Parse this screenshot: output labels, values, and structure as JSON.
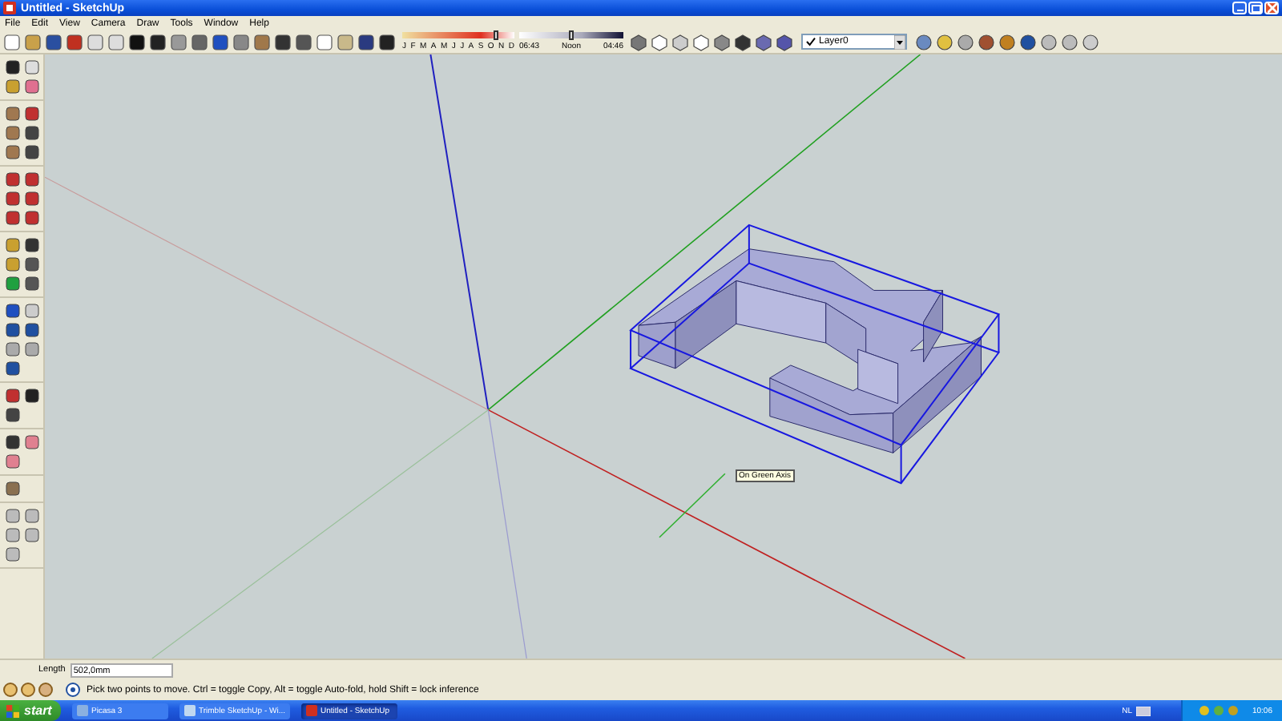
{
  "window": {
    "title": "Untitled - SketchUp"
  },
  "menu": [
    "File",
    "Edit",
    "View",
    "Camera",
    "Draw",
    "Tools",
    "Window",
    "Help"
  ],
  "toolbar": {
    "months": [
      "J",
      "F",
      "M",
      "A",
      "M",
      "J",
      "J",
      "A",
      "S",
      "O",
      "N",
      "D"
    ],
    "month_slider": {
      "level": 0.84
    },
    "time_slider": {
      "level": 0.5
    },
    "time_start": "06:43",
    "time_mid": "Noon",
    "time_end": "04:46",
    "layer": "Layer0"
  },
  "canvas": {
    "tooltip": "On Green Axis"
  },
  "measurements": {
    "label": "Length",
    "value": "502,0mm"
  },
  "status": {
    "message": "Pick two points to move.  Ctrl = toggle Copy, Alt = toggle Auto-fold, hold Shift = lock inference"
  },
  "taskbar": {
    "start": "start",
    "tasks": [
      {
        "label": "Picasa 3",
        "selected": false
      },
      {
        "label": "Trimble SketchUp - Wi...",
        "selected": false
      },
      {
        "label": "Untitled - SketchUp",
        "selected": true
      }
    ],
    "language": "NL",
    "clock": "10:06"
  }
}
